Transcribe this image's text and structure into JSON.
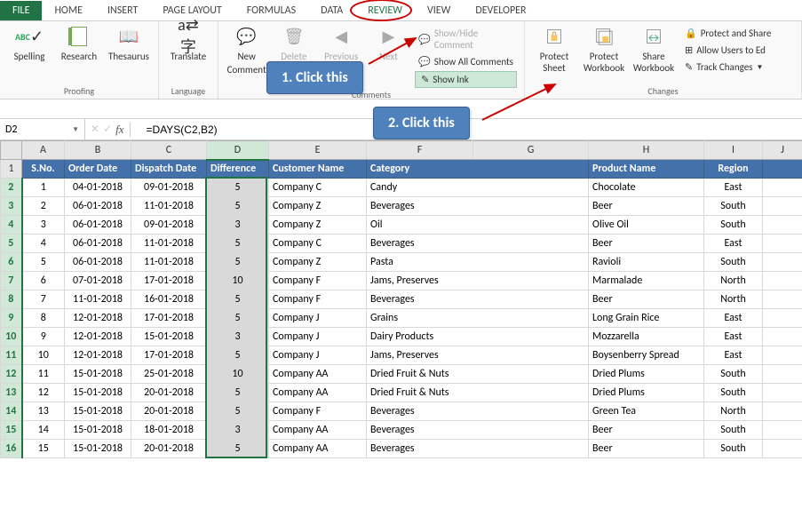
{
  "tabs": {
    "file": "FILE",
    "home": "HOME",
    "insert": "INSERT",
    "page_layout": "PAGE LAYOUT",
    "formulas": "FORMULAS",
    "data": "DATA",
    "review": "REVIEW",
    "view": "VIEW",
    "developer": "DEVELOPER"
  },
  "ribbon": {
    "proofing": {
      "label": "Proofing",
      "spelling": "Spelling",
      "research": "Research",
      "thesaurus": "Thesaurus",
      "abc": "ABC"
    },
    "language": {
      "label": "Language",
      "translate": "Translate"
    },
    "comments": {
      "label": "Comments",
      "new": "New",
      "comment": "Comment",
      "delete": "Delete",
      "previous": "Previous",
      "next": "Next",
      "showhide": "Show/Hide Comment",
      "showall": "Show All Comments",
      "showink": "Show Ink"
    },
    "changes": {
      "label": "Changes",
      "protect_sheet": "Protect Sheet",
      "protect_workbook": "Protect Workbook",
      "share_workbook": "Share Workbook",
      "protect_share": "Protect and Share",
      "allow_users": "Allow Users to Ed",
      "track_changes": "Track Changes"
    }
  },
  "callouts": {
    "c1": "1. Click this",
    "c2": "2. Click this"
  },
  "namebox": "D2",
  "formula": "=DAYS(C2,B2)",
  "columns": [
    "A",
    "B",
    "C",
    "D",
    "E",
    "F",
    "G",
    "H",
    "I",
    "J"
  ],
  "headers": {
    "sno": "S.No.",
    "order_date": "Order Date",
    "dispatch_date": "Dispatch Date",
    "difference": "Difference",
    "customer": "Customer Name",
    "category": "Category",
    "product": "Product Name",
    "region": "Region"
  },
  "rows": [
    {
      "sno": 1,
      "od": "04-01-2018",
      "dd": "09-01-2018",
      "diff": 5,
      "cust": "Company C",
      "cat": "Candy",
      "prod": "Chocolate",
      "reg": "East"
    },
    {
      "sno": 2,
      "od": "06-01-2018",
      "dd": "11-01-2018",
      "diff": 5,
      "cust": "Company Z",
      "cat": "Beverages",
      "prod": "Beer",
      "reg": "South"
    },
    {
      "sno": 3,
      "od": "06-01-2018",
      "dd": "09-01-2018",
      "diff": 3,
      "cust": "Company Z",
      "cat": "Oil",
      "prod": "Olive Oil",
      "reg": "South"
    },
    {
      "sno": 4,
      "od": "06-01-2018",
      "dd": "11-01-2018",
      "diff": 5,
      "cust": "Company C",
      "cat": "Beverages",
      "prod": "Beer",
      "reg": "East"
    },
    {
      "sno": 5,
      "od": "06-01-2018",
      "dd": "11-01-2018",
      "diff": 5,
      "cust": "Company Z",
      "cat": "Pasta",
      "prod": "Ravioli",
      "reg": "South"
    },
    {
      "sno": 6,
      "od": "07-01-2018",
      "dd": "17-01-2018",
      "diff": 10,
      "cust": "Company F",
      "cat": "Jams, Preserves",
      "prod": "Marmalade",
      "reg": "North"
    },
    {
      "sno": 7,
      "od": "11-01-2018",
      "dd": "16-01-2018",
      "diff": 5,
      "cust": "Company F",
      "cat": "Beverages",
      "prod": "Beer",
      "reg": "North"
    },
    {
      "sno": 8,
      "od": "12-01-2018",
      "dd": "17-01-2018",
      "diff": 5,
      "cust": "Company J",
      "cat": "Grains",
      "prod": "Long Grain Rice",
      "reg": "East"
    },
    {
      "sno": 9,
      "od": "12-01-2018",
      "dd": "15-01-2018",
      "diff": 3,
      "cust": "Company J",
      "cat": "Dairy Products",
      "prod": "Mozzarella",
      "reg": "East"
    },
    {
      "sno": 10,
      "od": "12-01-2018",
      "dd": "17-01-2018",
      "diff": 5,
      "cust": "Company J",
      "cat": "Jams, Preserves",
      "prod": "Boysenberry Spread",
      "reg": "East"
    },
    {
      "sno": 11,
      "od": "15-01-2018",
      "dd": "25-01-2018",
      "diff": 10,
      "cust": "Company AA",
      "cat": "Dried Fruit & Nuts",
      "prod": "Dried Plums",
      "reg": "South"
    },
    {
      "sno": 12,
      "od": "15-01-2018",
      "dd": "20-01-2018",
      "diff": 5,
      "cust": "Company AA",
      "cat": "Dried Fruit & Nuts",
      "prod": "Dried Plums",
      "reg": "South"
    },
    {
      "sno": 13,
      "od": "15-01-2018",
      "dd": "20-01-2018",
      "diff": 5,
      "cust": "Company F",
      "cat": "Beverages",
      "prod": "Green Tea",
      "reg": "North"
    },
    {
      "sno": 14,
      "od": "15-01-2018",
      "dd": "18-01-2018",
      "diff": 3,
      "cust": "Company AA",
      "cat": "Beverages",
      "prod": "Beer",
      "reg": "South"
    },
    {
      "sno": 15,
      "od": "15-01-2018",
      "dd": "20-01-2018",
      "diff": 5,
      "cust": "Company AA",
      "cat": "Beverages",
      "prod": "Beer",
      "reg": "South"
    }
  ]
}
